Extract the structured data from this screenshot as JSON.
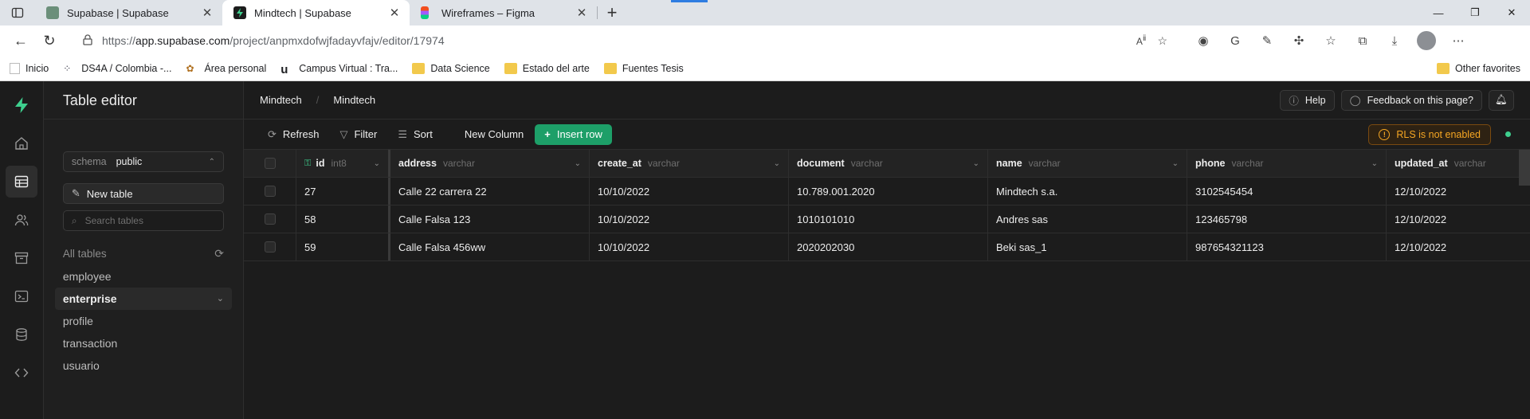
{
  "browser": {
    "tabs": [
      {
        "title": "Supabase | Supabase",
        "favicon_color": "#6b8f7a"
      },
      {
        "title": "Mindtech | Supabase",
        "favicon_color": "#1c1c1c"
      },
      {
        "title": "Wireframes – Figma",
        "favicon_color": "#f24e1e"
      }
    ],
    "url_prefix": "https://",
    "url_host": "app.supabase.com",
    "url_path": "/project/anpmxdofwjfadayvfajv/editor/17974",
    "bookmarks": [
      {
        "label": "Inicio",
        "icon": "page-icon"
      },
      {
        "label": "DS4A / Colombia -...",
        "icon": "ds4a-icon"
      },
      {
        "label": "Área personal",
        "icon": "moodle-icon"
      },
      {
        "label": "Campus Virtual : Tra...",
        "icon": "u-icon"
      },
      {
        "label": "Data Science",
        "icon": "folder-icon"
      },
      {
        "label": "Estado del arte",
        "icon": "folder-icon"
      },
      {
        "label": "Fuentes Tesis",
        "icon": "folder-icon"
      }
    ],
    "other_favorites": "Other favorites"
  },
  "sidebar": {
    "title": "Table editor",
    "schema_label": "schema",
    "schema_value": "public",
    "new_table": "New table",
    "search_placeholder": "Search tables",
    "all_tables": "All tables",
    "tables": [
      {
        "name": "employee",
        "active": false
      },
      {
        "name": "enterprise",
        "active": true
      },
      {
        "name": "profile",
        "active": false
      },
      {
        "name": "transaction",
        "active": false
      },
      {
        "name": "usuario",
        "active": false
      }
    ]
  },
  "header": {
    "breadcrumb": [
      "Mindtech",
      "Mindtech"
    ],
    "help": "Help",
    "feedback": "Feedback on this page?"
  },
  "toolbar": {
    "refresh": "Refresh",
    "filter": "Filter",
    "sort": "Sort",
    "new_column": "New Column",
    "insert_row": "Insert row",
    "rls": "RLS is not enabled"
  },
  "table": {
    "columns": [
      {
        "name": "id",
        "type": "int8",
        "key": true
      },
      {
        "name": "address",
        "type": "varchar"
      },
      {
        "name": "create_at",
        "type": "varchar"
      },
      {
        "name": "document",
        "type": "varchar"
      },
      {
        "name": "name",
        "type": "varchar"
      },
      {
        "name": "phone",
        "type": "varchar"
      },
      {
        "name": "updated_at",
        "type": "varchar"
      }
    ],
    "rows": [
      [
        "27",
        "Calle 22 carrera 22",
        "10/10/2022",
        "10.789.001.2020",
        "Mindtech s.a.",
        "3102545454",
        "12/10/2022"
      ],
      [
        "58",
        "Calle Falsa 123",
        "10/10/2022",
        "1010101010",
        "Andres sas",
        "123465798",
        "12/10/2022"
      ],
      [
        "59",
        "Calle Falsa 456ww",
        "10/10/2022",
        "2020202030",
        "Beki sas_1",
        "987654321123",
        "12/10/2022"
      ]
    ]
  },
  "colors": {
    "accent": "#3ecf8e",
    "insert_button": "#1d9f68",
    "warning": "#f5a623"
  }
}
